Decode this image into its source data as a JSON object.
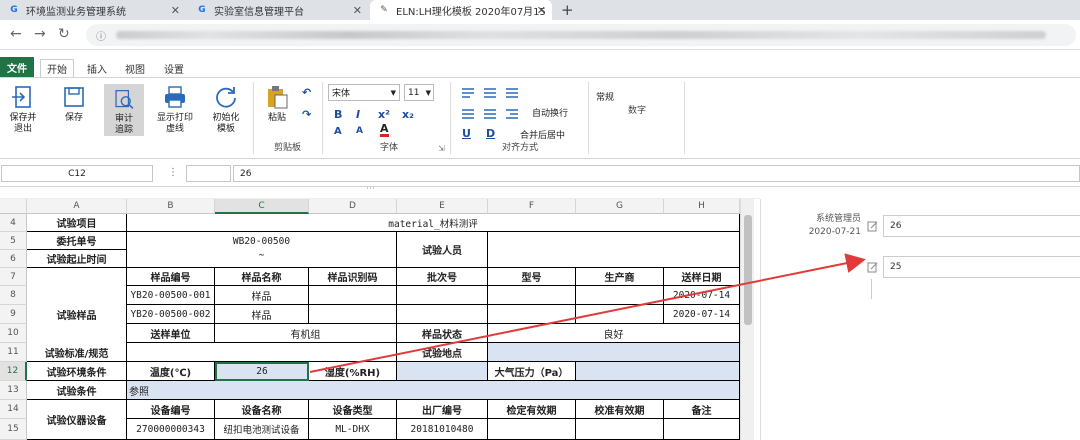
{
  "browser": {
    "tabs": [
      {
        "label": "环境监测业务管理系统",
        "active": false
      },
      {
        "label": "实验室信息管理平台",
        "active": false
      },
      {
        "label": "ELN:LH理化模板 2020年07月15",
        "active": true
      }
    ],
    "new_tab": "+",
    "info_icon": "ⓘ"
  },
  "menu": {
    "file": "文件",
    "tabs": [
      "开始",
      "插入",
      "视图",
      "设置"
    ]
  },
  "ribbon": {
    "buttons": [
      {
        "label": "保存并\n退出"
      },
      {
        "label": "保存"
      },
      {
        "label": "审计\n追踪"
      },
      {
        "label": "显示打印\n虚线"
      },
      {
        "label": "初始化\n模板"
      },
      {
        "label": "粘贴"
      }
    ],
    "font_name": "宋体",
    "font_size": "11",
    "number_format": "常规",
    "wrap_text": "自动换行",
    "merge_center": "合并后居中",
    "groups": [
      "剪贴板",
      "字体",
      "对齐方式",
      "数字"
    ],
    "font_buttons": [
      "B",
      "I",
      "x²",
      "x₂",
      "A",
      "A",
      "A"
    ],
    "align_buttons": [
      "U",
      "D"
    ]
  },
  "formula_bar": {
    "cell_ref": "C12",
    "fx": "⋮",
    "value": "26"
  },
  "columns": [
    "A",
    "B",
    "C",
    "D",
    "E",
    "F",
    "G",
    "H"
  ],
  "rows": [
    "4",
    "5",
    "6",
    "7",
    "8",
    "9",
    "10",
    "11",
    "12",
    "13",
    "14",
    "15"
  ],
  "sheet": {
    "r4_label": "试验项目",
    "r4_value": "material_材料测评",
    "r5_label": "委托单号",
    "r5_value": "WB20-00500",
    "r6_label": "试验起止时间",
    "r6_value": "~",
    "tester_label": "试验人员",
    "sample_label": "试验样品",
    "h_sample_no": "样品编号",
    "h_sample_name": "样品名称",
    "h_sample_id": "样品识别码",
    "h_batch": "批次号",
    "h_model": "型号",
    "h_maker": "生产商",
    "h_date": "送样日期",
    "r8_no": "YB20-00500-001",
    "r8_name": "样品",
    "r8_date": "2020-07-14",
    "r9_no": "YB20-00500-002",
    "r9_name": "样品",
    "r9_date": "2020-07-14",
    "h_unit": "送样单位",
    "unit_value": "有机组",
    "h_state": "样品状态",
    "state_value": "良好",
    "r11_label": "试验标准/规范",
    "place_label": "试验地点",
    "r12_label": "试验环境条件",
    "temp_label": "温度(℃)",
    "temp_value": "26",
    "hum_label": "湿度(%RH)",
    "press_label": "大气压力（Pa）",
    "r13_label": "试验条件",
    "r13_value": "参照",
    "r14_label": "试验仪器设备",
    "h_eq_no": "设备编号",
    "h_eq_name": "设备名称",
    "h_eq_type": "设备类型",
    "h_factory": "出厂编号",
    "h_valid": "检定有效期",
    "h_calib": "校准有效期",
    "h_note": "备注",
    "r15_no": "270000000343",
    "r15_name": "纽扣电池测试设备",
    "r15_type": "ML-DHX",
    "r15_factory": "20181010480"
  },
  "side_panel": {
    "author": "系统管理员",
    "date": "2020-07-21",
    "entries": [
      {
        "value": "26"
      },
      {
        "value": "25"
      }
    ]
  },
  "colors": {
    "excel_green": "#217346",
    "input_fill": "#dae3f1",
    "arrow": "#e23a3a"
  }
}
